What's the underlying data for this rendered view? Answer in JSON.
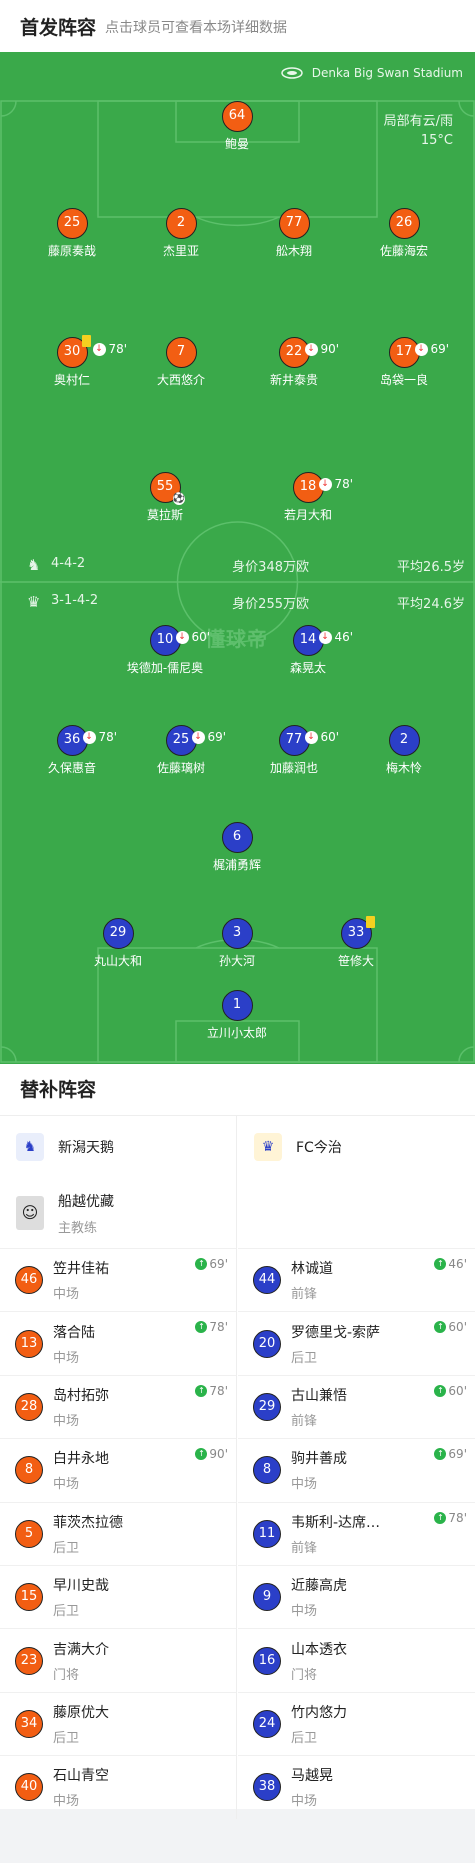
{
  "header": {
    "title": "首发阵容",
    "subtitle": "点击球员可查看本场详细数据"
  },
  "match": {
    "stadium": "Denka Big Swan Stadium",
    "weather": "局部有云/雨",
    "temperature": "15°C"
  },
  "home": {
    "crest": "新潟天鹅-crest-icon",
    "formation": "4-4-2",
    "value": "身价348万欧",
    "avg_age": "平均26.5岁",
    "players": [
      {
        "num": "64",
        "name": "鲍曼"
      },
      {
        "num": "25",
        "name": "藤原奏哉"
      },
      {
        "num": "2",
        "name": "杰里亚"
      },
      {
        "num": "77",
        "name": "舩木翔"
      },
      {
        "num": "26",
        "name": "佐藤海宏"
      },
      {
        "num": "30",
        "name": "奥村仁",
        "sub_time": "78'",
        "yellow_card": true
      },
      {
        "num": "7",
        "name": "大西悠介"
      },
      {
        "num": "22",
        "name": "新井泰贵",
        "sub_time": "90'"
      },
      {
        "num": "17",
        "name": "岛袋一良",
        "sub_time": "69'"
      },
      {
        "num": "55",
        "name": "莫拉斯",
        "goal": true
      },
      {
        "num": "18",
        "name": "若月大和",
        "sub_time": "78'"
      }
    ]
  },
  "away": {
    "crest": "FC今治-crest-icon",
    "formation": "3-1-4-2",
    "value": "身价255万欧",
    "avg_age": "平均24.6岁",
    "players": [
      {
        "num": "10",
        "name": "埃德加-儒尼奥",
        "sub_time": "60'"
      },
      {
        "num": "14",
        "name": "森晃太",
        "sub_time": "46'"
      },
      {
        "num": "36",
        "name": "久保惠音",
        "sub_time": "78'"
      },
      {
        "num": "25",
        "name": "佐藤璃树",
        "sub_time": "69'"
      },
      {
        "num": "77",
        "name": "加藤润也",
        "sub_time": "60'"
      },
      {
        "num": "2",
        "name": "梅木怜"
      },
      {
        "num": "6",
        "name": "梶浦勇辉"
      },
      {
        "num": "29",
        "name": "丸山大和"
      },
      {
        "num": "3",
        "name": "孙大河"
      },
      {
        "num": "33",
        "name": "笹修大",
        "yellow_card": true
      },
      {
        "num": "1",
        "name": "立川小太郎"
      }
    ]
  },
  "subs": {
    "title": "替补阵容",
    "home_team": "新潟天鹅",
    "away_team": "FC今治",
    "coach_name": "船越优藏",
    "coach_role": "主教练",
    "home": [
      {
        "num": "46",
        "name": "笠井佳祐",
        "pos": "中场",
        "in": "69'"
      },
      {
        "num": "13",
        "name": "落合陆",
        "pos": "中场",
        "in": "78'"
      },
      {
        "num": "28",
        "name": "岛村拓弥",
        "pos": "中场",
        "in": "78'"
      },
      {
        "num": "8",
        "name": "白井永地",
        "pos": "中场",
        "in": "90'"
      },
      {
        "num": "5",
        "name": "菲茨杰拉德",
        "pos": "后卫"
      },
      {
        "num": "15",
        "name": "早川史哉",
        "pos": "后卫"
      },
      {
        "num": "23",
        "name": "吉满大介",
        "pos": "门将"
      },
      {
        "num": "34",
        "name": "藤原优大",
        "pos": "后卫"
      },
      {
        "num": "40",
        "name": "石山青空",
        "pos": "中场"
      }
    ],
    "away": [
      {
        "num": "44",
        "name": "林诚道",
        "pos": "前锋",
        "in": "46'"
      },
      {
        "num": "20",
        "name": "罗德里戈-索萨",
        "pos": "后卫",
        "in": "60'"
      },
      {
        "num": "29",
        "name": "古山兼悟",
        "pos": "前锋",
        "in": "60'"
      },
      {
        "num": "8",
        "name": "驹井善成",
        "pos": "中场",
        "in": "69'"
      },
      {
        "num": "11",
        "name": "韦斯利-达席…",
        "pos": "前锋",
        "in": "78'"
      },
      {
        "num": "9",
        "name": "近藤高虎",
        "pos": "中场"
      },
      {
        "num": "16",
        "name": "山本透衣",
        "pos": "门将"
      },
      {
        "num": "24",
        "name": "竹内悠力",
        "pos": "后卫"
      },
      {
        "num": "38",
        "name": "马越晃",
        "pos": "中场"
      }
    ]
  }
}
